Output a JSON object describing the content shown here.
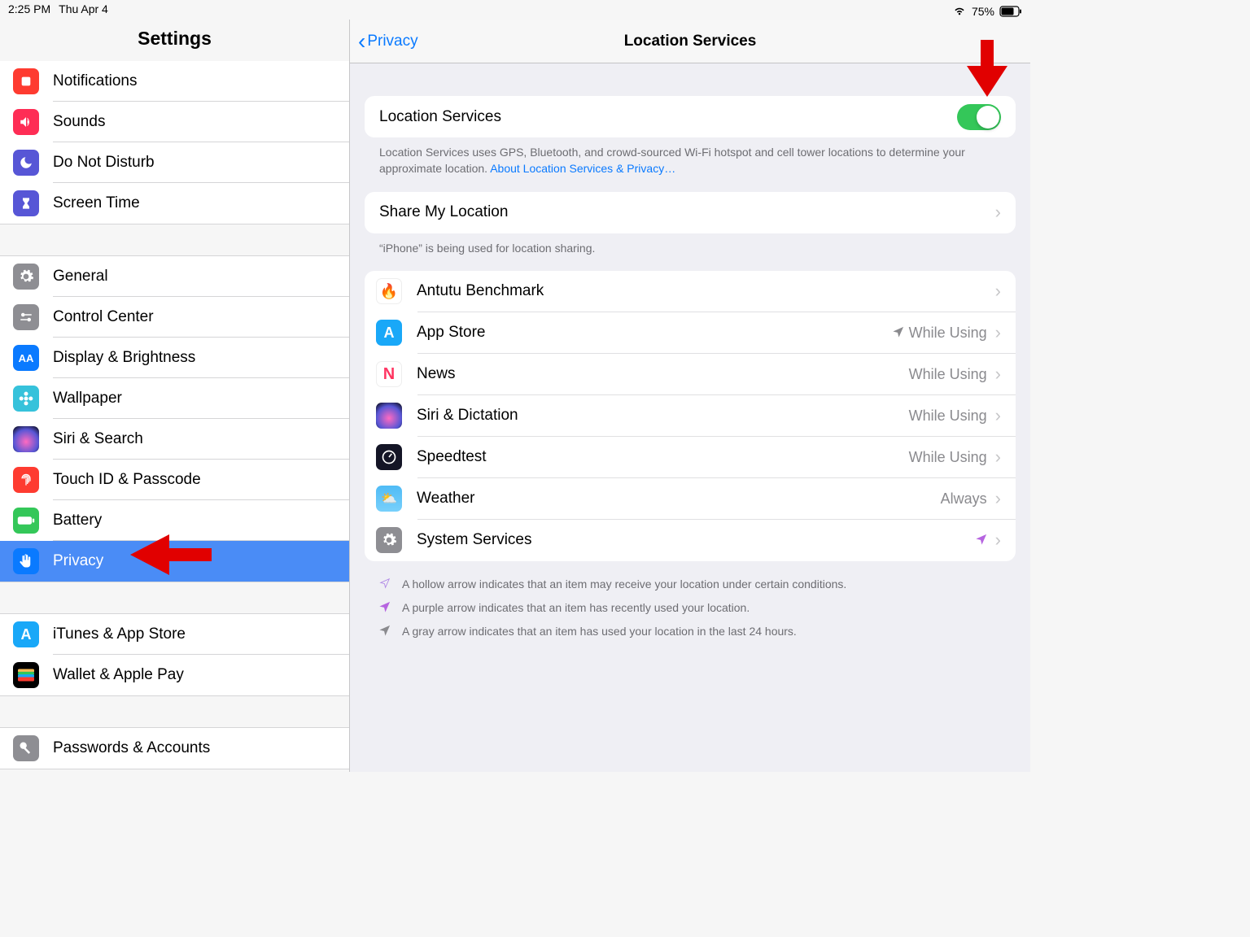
{
  "statusbar": {
    "time": "2:25 PM",
    "date": "Thu Apr 4",
    "battery_pct": "75%"
  },
  "sidebar": {
    "title": "Settings",
    "groups": [
      {
        "cls": "first",
        "items": [
          {
            "icon": "ic-notif",
            "label": "Notifications",
            "name": "nav-notifications",
            "glyph": "square"
          },
          {
            "icon": "ic-sounds",
            "label": "Sounds",
            "name": "nav-sounds",
            "glyph": "speaker"
          },
          {
            "icon": "ic-dnd",
            "label": "Do Not Disturb",
            "name": "nav-dnd",
            "glyph": "moon"
          },
          {
            "icon": "ic-screentime",
            "label": "Screen Time",
            "name": "nav-screentime",
            "glyph": "hourglass"
          }
        ]
      },
      {
        "items": [
          {
            "icon": "ic-general",
            "label": "General",
            "name": "nav-general",
            "glyph": "gear"
          },
          {
            "icon": "ic-control",
            "label": "Control Center",
            "name": "nav-control-center",
            "glyph": "switches"
          },
          {
            "icon": "ic-display",
            "label": "Display & Brightness",
            "name": "nav-display",
            "glyph": "AA"
          },
          {
            "icon": "ic-wallpaper",
            "label": "Wallpaper",
            "name": "nav-wallpaper",
            "glyph": "flower"
          },
          {
            "icon": "ic-siri",
            "label": "Siri & Search",
            "name": "nav-siri",
            "glyph": "siri"
          },
          {
            "icon": "ic-touchid",
            "label": "Touch ID & Passcode",
            "name": "nav-touchid",
            "glyph": "fingerprint"
          },
          {
            "icon": "ic-battery",
            "label": "Battery",
            "name": "nav-battery",
            "glyph": "battery"
          },
          {
            "icon": "ic-privacy",
            "label": "Privacy",
            "name": "nav-privacy",
            "glyph": "hand",
            "selected": true
          }
        ]
      },
      {
        "items": [
          {
            "icon": "ic-itunes",
            "label": "iTunes & App Store",
            "name": "nav-itunes",
            "glyph": "A"
          },
          {
            "icon": "ic-wallet",
            "label": "Wallet & Apple Pay",
            "name": "nav-wallet",
            "glyph": "wallet"
          }
        ]
      },
      {
        "items": [
          {
            "icon": "ic-passwords",
            "label": "Passwords & Accounts",
            "name": "nav-passwords",
            "glyph": "key"
          }
        ]
      }
    ]
  },
  "detail": {
    "back_label": "Privacy",
    "title": "Location Services",
    "toggle": {
      "label": "Location Services",
      "on": true
    },
    "toggle_desc": "Location Services uses GPS, Bluetooth, and crowd-sourced Wi-Fi hotspot and cell tower locations to determine your approximate location. ",
    "toggle_link": "About Location Services & Privacy…",
    "share_label": "Share My Location",
    "share_desc": "“iPhone” is being used for location sharing.",
    "apps": [
      {
        "icon": "ic-antutu",
        "label": "Antutu Benchmark",
        "value": "",
        "name": "app-antutu",
        "glyph": "🔥"
      },
      {
        "icon": "ic-appstore",
        "label": "App Store",
        "value": "While Using",
        "arrow": "gray",
        "name": "app-appstore",
        "glyph": "A"
      },
      {
        "icon": "ic-news",
        "label": "News",
        "value": "While Using",
        "name": "app-news",
        "glyph": "N"
      },
      {
        "icon": "ic-siridict",
        "label": "Siri & Dictation",
        "value": "While Using",
        "name": "app-siri",
        "glyph": "siri"
      },
      {
        "icon": "ic-speedtest",
        "label": "Speedtest",
        "value": "While Using",
        "name": "app-speedtest",
        "glyph": "gauge"
      },
      {
        "icon": "ic-weather",
        "label": "Weather",
        "value": "Always",
        "name": "app-weather",
        "glyph": "☀"
      },
      {
        "icon": "ic-system",
        "label": "System Services",
        "value": "",
        "arrow": "purple",
        "name": "app-system",
        "glyph": "gear"
      }
    ],
    "legend": [
      {
        "color": "#b087e6",
        "hollow": true,
        "text": "A hollow arrow indicates that an item may receive your location under certain conditions."
      },
      {
        "color": "#b664e0",
        "text": "A purple arrow indicates that an item has recently used your location."
      },
      {
        "color": "#8a8a8e",
        "text": "A gray arrow indicates that an item has used your location in the last 24 hours."
      }
    ]
  }
}
